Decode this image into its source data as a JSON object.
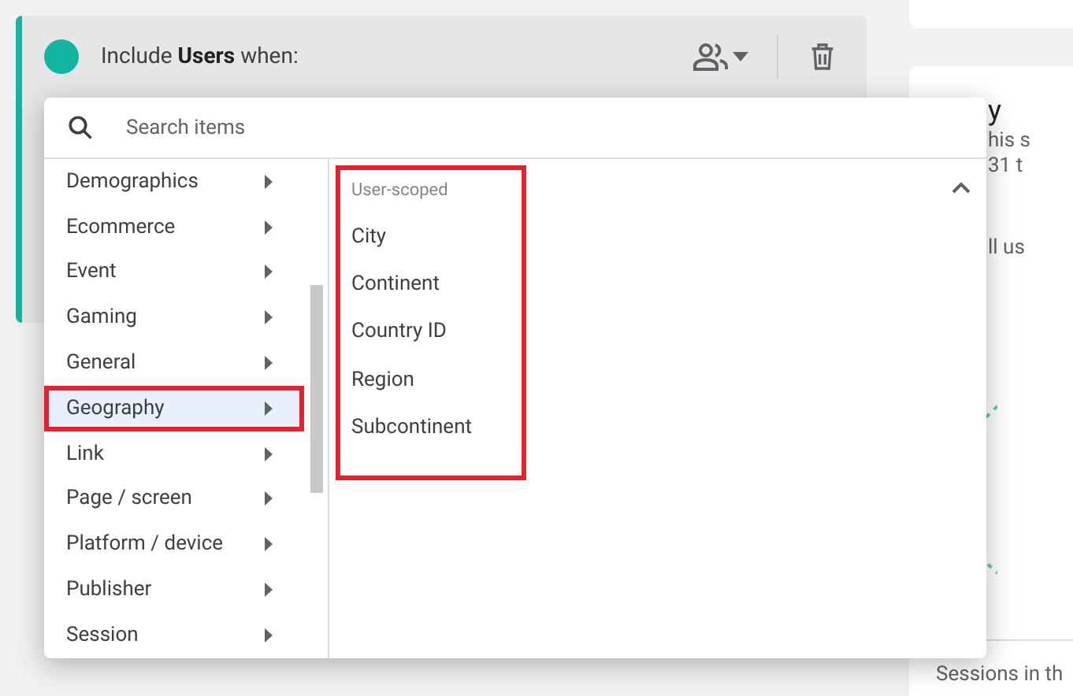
{
  "condition": {
    "text": "Include **Users** when:"
  },
  "search": {
    "placeholder": "Search items"
  },
  "categories": [
    {
      "label": "Demographics",
      "selected": false,
      "highlighted": false
    },
    {
      "label": "Ecommerce",
      "selected": false,
      "highlighted": false
    },
    {
      "label": "Event",
      "selected": false,
      "highlighted": false
    },
    {
      "label": "Gaming",
      "selected": false,
      "highlighted": false
    },
    {
      "label": "General",
      "selected": false,
      "highlighted": false
    },
    {
      "label": "Geography",
      "selected": true,
      "highlighted": true
    },
    {
      "label": "Link",
      "selected": false,
      "highlighted": false
    },
    {
      "label": "Page / screen",
      "selected": false,
      "highlighted": false
    },
    {
      "label": "Platform / device",
      "selected": false,
      "highlighted": false
    },
    {
      "label": "Publisher",
      "selected": false,
      "highlighted": false
    },
    {
      "label": "Session",
      "selected": false,
      "highlighted": false
    }
  ],
  "subgroup": {
    "heading": "User-scoped",
    "expanded": true,
    "highlighted": true,
    "items": [
      "City",
      "Continent",
      "Country ID",
      "Region",
      "Subcontinent"
    ]
  },
  "side_card": {
    "title": "y",
    "lines": [
      "his s",
      "31 t",
      "ll us"
    ],
    "footer": "Sessions in th"
  }
}
